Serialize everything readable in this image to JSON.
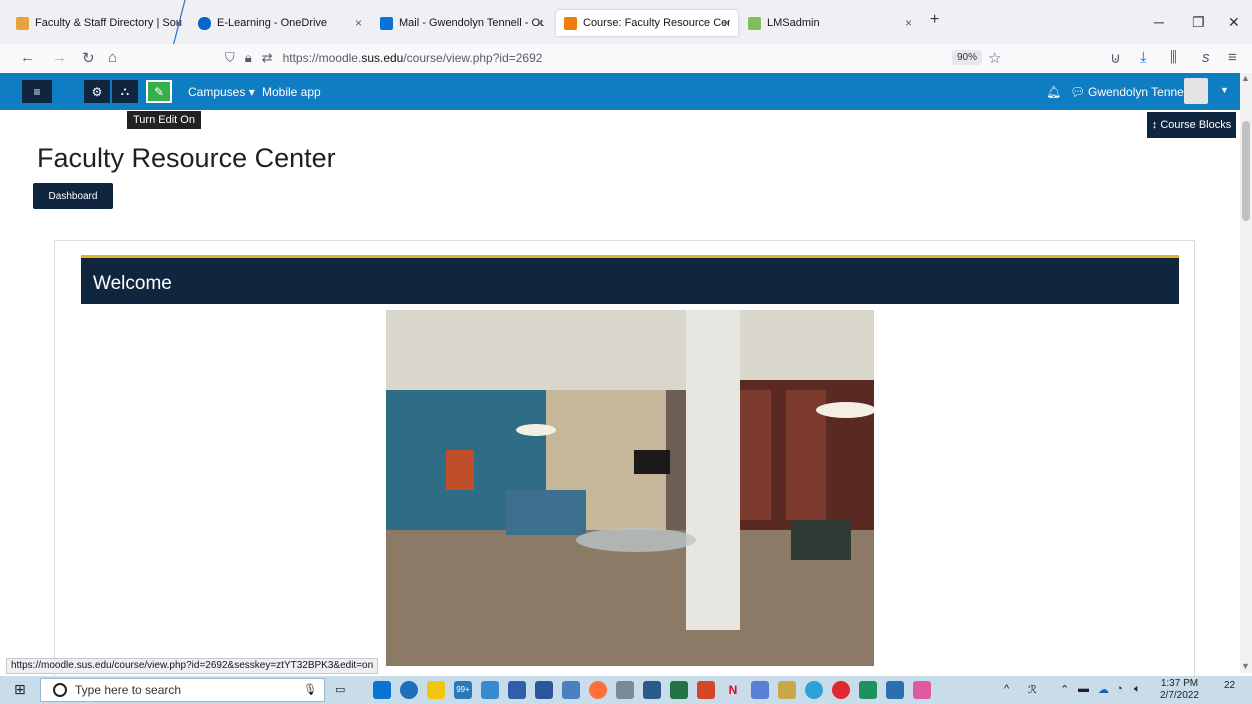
{
  "browser": {
    "tabs": [
      {
        "label": "Faculty & Staff Directory | South",
        "icon_color": "#e8a33a",
        "active": false
      },
      {
        "label": "E-Learning - OneDrive",
        "icon_color": "#0a64c8",
        "active": false
      },
      {
        "label": "Mail - Gwendolyn Tennell - Outl",
        "icon_color": "#0a74d4",
        "active": false
      },
      {
        "label": "Course: Faculty Resource Center",
        "icon_color": "#f27b0c",
        "active": true
      },
      {
        "label": "LMSadmin",
        "icon_color": "#7fbf5a",
        "active": false
      }
    ],
    "tab_close": "×",
    "new_tab": "+",
    "url_prefix": "https://moodle.",
    "url_domain": "sus.edu",
    "url_suffix": "/course/view.php?id=2692",
    "zoom": "90%",
    "status_url": "https://moodle.sus.edu/course/view.php?id=2692&sesskey=ztYT32BPK3&edit=on"
  },
  "moodle": {
    "menu_links": [
      "Campuses ▾",
      "Mobile app"
    ],
    "user_name": "Gwendolyn Tennell",
    "tooltip": "Turn Edit On",
    "course_blocks": "Course Blocks",
    "page_title": "Faculty Resource Center",
    "dashboard_button": "Dashboard",
    "section_title": "Welcome"
  },
  "taskbar": {
    "search_placeholder": "Type here to search",
    "time": "1:37 PM",
    "date": "2/7/2022",
    "notification_count": "22",
    "badge": "99+"
  },
  "colors": {
    "moodle_blue": "#0f7dc2",
    "navy": "#10263f",
    "edit_green": "#35b04a",
    "gold": "#e6b325"
  }
}
